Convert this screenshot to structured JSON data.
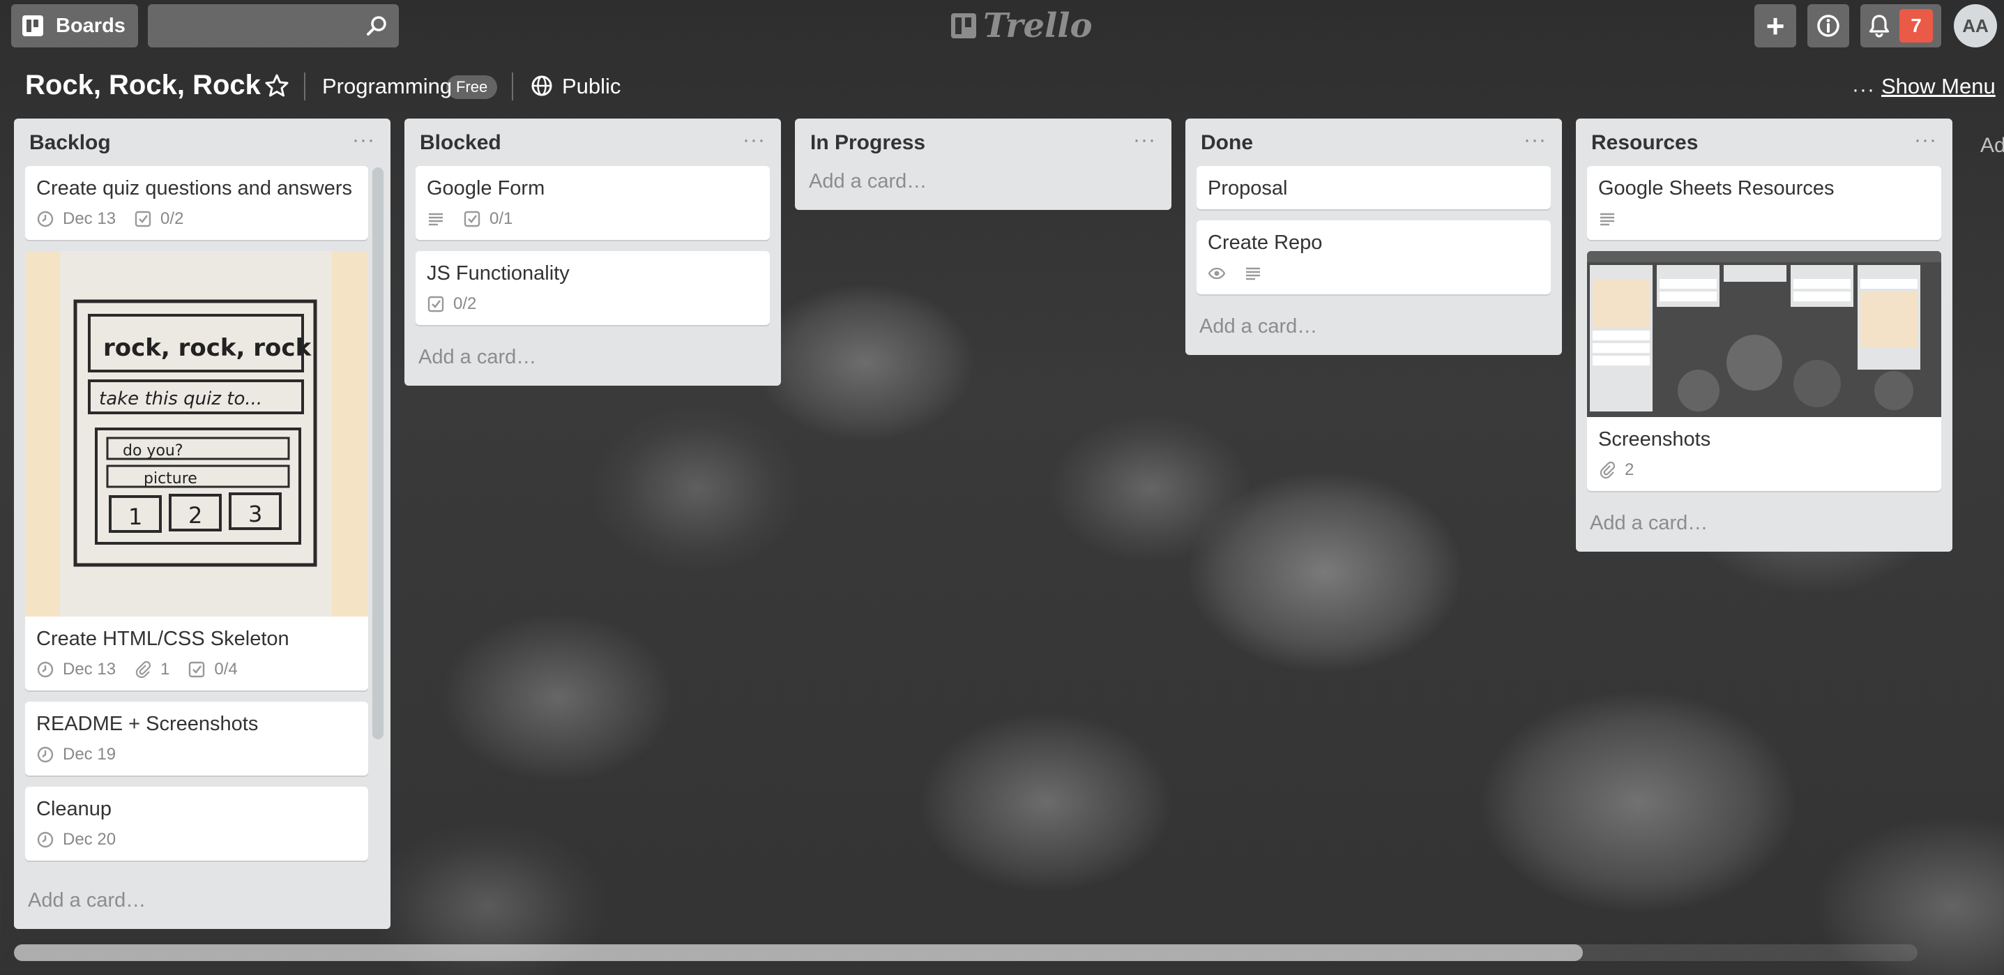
{
  "app": {
    "logo_text": "Trello"
  },
  "header": {
    "boards_label": "Boards",
    "search": {
      "value": "",
      "placeholder": ""
    },
    "add_label": "+",
    "notifications_count": "7",
    "avatar_initials": "AA"
  },
  "board": {
    "title": "Rock, Rock, Rock",
    "team": "Programming",
    "team_badge": "Free",
    "visibility": "Public",
    "menu_dots": "···",
    "show_menu": "Show Menu",
    "add_list_peek": "Ad"
  },
  "lists": [
    {
      "title": "Backlog",
      "menu": "···",
      "cards": [
        {
          "title": "Create quiz questions and answers",
          "due": "Dec 13",
          "checklist": "0/2"
        },
        {
          "title": "Create HTML/CSS Skeleton",
          "due": "Dec 13",
          "attachments": "1",
          "checklist": "0/4",
          "sketch_lines": [
            "rock, rock, rock",
            "take this quiz to...",
            "do you?",
            "picture",
            "1",
            "2",
            "3"
          ]
        },
        {
          "title": "README + Screenshots",
          "due": "Dec 19"
        },
        {
          "title": "Cleanup",
          "due": "Dec 20"
        }
      ],
      "add_card": "Add a card…"
    },
    {
      "title": "Blocked",
      "menu": "···",
      "cards": [
        {
          "title": "Google Form",
          "checklist": "0/1"
        },
        {
          "title": "JS Functionality",
          "checklist": "0/2"
        }
      ],
      "add_card": "Add a card…"
    },
    {
      "title": "In Progress",
      "menu": "···",
      "cards": [],
      "add_card": "Add a card…"
    },
    {
      "title": "Done",
      "menu": "···",
      "cards": [
        {
          "title": "Proposal"
        },
        {
          "title": "Create Repo"
        }
      ],
      "add_card": "Add a card…"
    },
    {
      "title": "Resources",
      "menu": "···",
      "cards": [
        {
          "title": "Google Sheets Resources"
        },
        {
          "title": "Screenshots",
          "attachments": "2"
        }
      ],
      "add_card": "Add a card…"
    }
  ],
  "colors": {
    "notification_badge": "#eb5a46",
    "list_background": "#e2e4e6",
    "card_background": "#ffffff"
  }
}
